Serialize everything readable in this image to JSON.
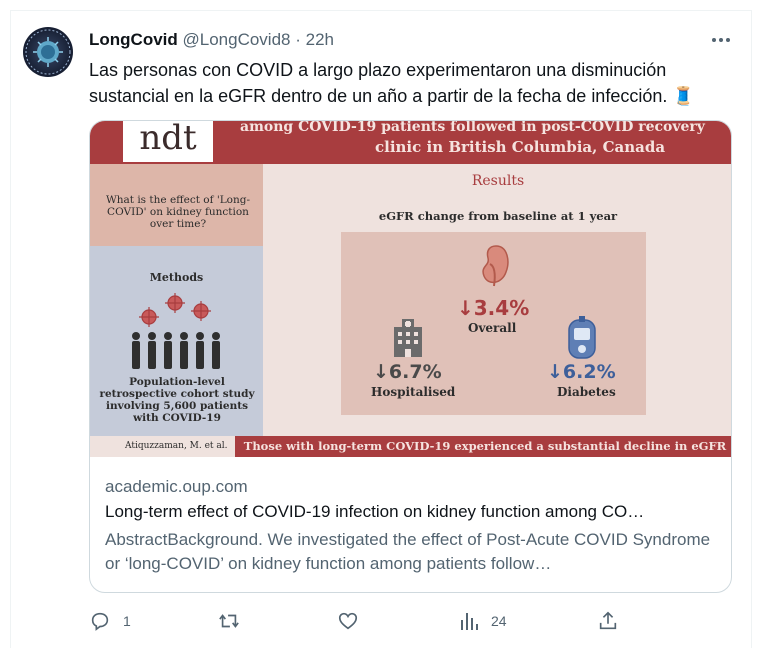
{
  "tweet": {
    "display_name": "LongCovid",
    "handle": "@LongCovid8",
    "separator": "·",
    "time": "22h",
    "text": "Las personas con COVID a largo plazo experimentaron una disminución sustancial en la eGFR dentro de un año a partir de la fecha de infección.",
    "emoji": "🧵"
  },
  "avatar": {
    "label": "LONG COVID AWARENESS"
  },
  "card_image": {
    "logo_text": "ndt",
    "banner_line1": "among COVID-19 patients followed in post-COVID recovery",
    "banner_line2": "clinic in British Columbia, Canada",
    "question": "What is the effect of 'Long-COVID' on kidney function over time?",
    "methods_title": "Methods",
    "methods_desc": "Population-level retrospective cohort study involving 5,600 patients with COVID-19",
    "results_title": "Results",
    "egfr_title": "eGFR change from baseline at 1 year",
    "overall_value": "↓3.4%",
    "overall_label": "Overall",
    "hospitalised_value": "↓6.7%",
    "hospitalised_label": "Hospitalised",
    "diabetes_value": "↓6.2%",
    "diabetes_label": "Diabetes",
    "citation": "Atiquzzaman, M. et al.",
    "conclusion": "Those with long-term COVID-19 experienced a substantial decline in eGFR",
    "colors": {
      "maroon": "#a83d3f",
      "blue": "#3d5f9a"
    }
  },
  "card": {
    "domain": "academic.oup.com",
    "title": "Long-term effect of COVID-19 infection on kidney function among CO…",
    "description": "AbstractBackground. We investigated the effect of Post-Acute COVID Syndrome or ‘long-COVID’ on kidney function among patients follow…"
  },
  "actions": {
    "reply_count": "1",
    "retweet_count": "",
    "like_count": "",
    "views_count": "24",
    "icons": [
      "reply-icon",
      "retweet-icon",
      "like-icon",
      "views-icon",
      "share-icon"
    ]
  }
}
